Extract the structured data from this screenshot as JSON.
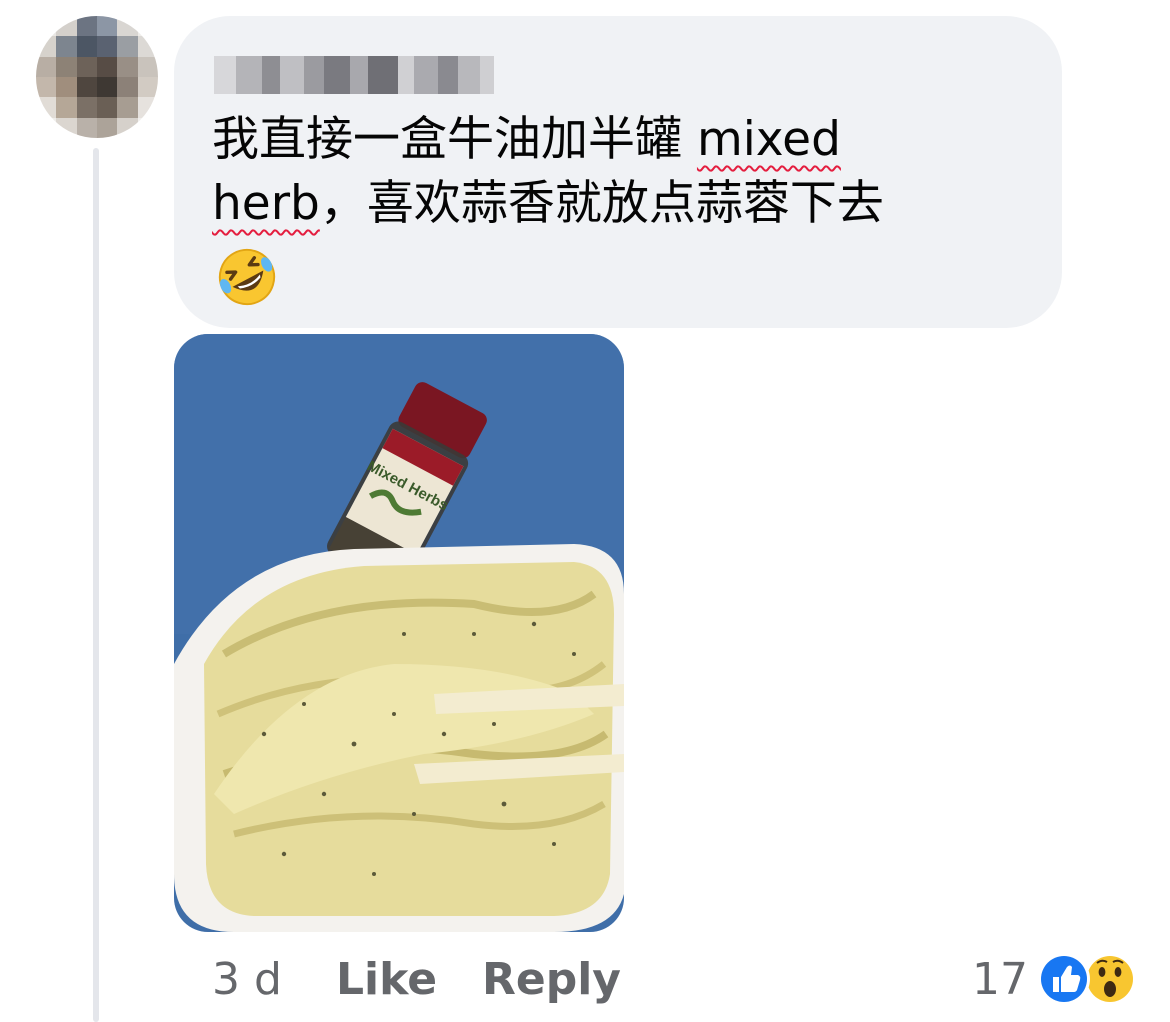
{
  "comment": {
    "text_part1": "我直接一盒牛油加半罐 ",
    "text_misspelled1": "mixed",
    "text_misspelled2": "herb",
    "text_part2": "，喜欢蒜香就放点蒜蓉下去",
    "emoji": "rolling-on-floor-laughing-emoji",
    "image_label": "Mixed Herbs"
  },
  "actions": {
    "time": "3 d",
    "like": "Like",
    "reply": "Reply"
  },
  "reactions": {
    "count": "17",
    "types": [
      "like-reaction-icon",
      "wow-reaction-icon"
    ]
  },
  "colors": {
    "bubble": "#f0f2f5",
    "secondary_text": "#65676b",
    "like_blue": "#1877f2",
    "spell_red": "#e41e3f"
  }
}
